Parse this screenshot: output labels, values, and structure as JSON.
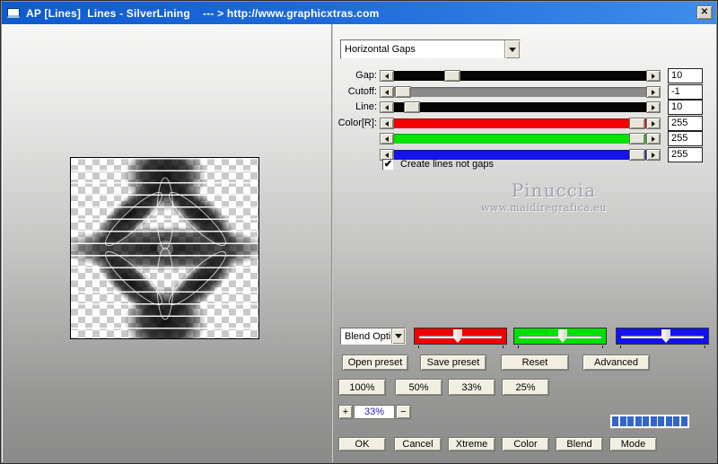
{
  "window": {
    "title": "AP [Lines]  Lines - SilverLining    --- > http://www.graphicxtras.com"
  },
  "icons": {
    "close": "✕",
    "check": "✔"
  },
  "colors": {
    "titlebar_start": "#0f5ad0",
    "titlebar_end": "#3f8dec",
    "progress_segment": "#3465c8",
    "zoom_value_text": "#2222bb",
    "slider_gap_track": "#050505",
    "slider_cutoff_track": "#8a8a8a",
    "slider_line_track": "#050505",
    "slider_red_track": "#f20202",
    "slider_green_track": "#04e404",
    "slider_blue_track": "#1414ea"
  },
  "controls": {
    "mode_dropdown": {
      "value": "Horizontal Gaps"
    },
    "sliders": [
      {
        "label": "Gap:",
        "value": "10"
      },
      {
        "label": "Cutoff:",
        "value": "-1"
      },
      {
        "label": "Line:",
        "value": "10"
      },
      {
        "label": "Color[R]:",
        "value": "255"
      },
      {
        "label": "",
        "value": "255"
      },
      {
        "label": "",
        "value": "255"
      }
    ],
    "checkbox": {
      "label": "Create lines not gaps",
      "checked": true
    },
    "blend_dropdown": {
      "value": "Blend Opti"
    },
    "channel_sliders": [
      {
        "name": "red",
        "color": "#ee0202"
      },
      {
        "name": "green",
        "color": "#02e002"
      },
      {
        "name": "blue",
        "color": "#1212ee"
      }
    ],
    "preset_buttons": [
      "Open preset",
      "Save preset",
      "Reset",
      "Advanced"
    ],
    "percent_buttons": [
      "100%",
      "50%",
      "33%",
      "25%"
    ],
    "zoom_control": {
      "plus": "+",
      "value": "33%",
      "minus": "−"
    },
    "progress_segments": 10,
    "action_buttons": [
      "OK",
      "Cancel",
      "Xtreme",
      "Color",
      "Blend",
      "Mode"
    ]
  },
  "watermark": {
    "line1": "Pinuccia",
    "line2": "www.maidiregrafica.eu"
  }
}
